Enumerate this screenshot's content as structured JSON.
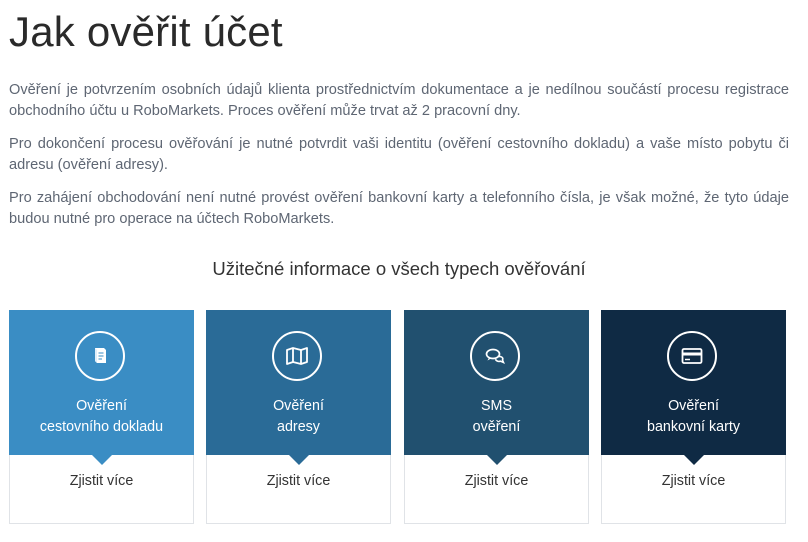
{
  "page": {
    "title": "Jak ověřit účet",
    "paragraphs": [
      "Ověření je potvrzením osobních údajů klienta prostřednictvím dokumentace a je nedílnou součástí procesu registrace obchodního účtu u RoboMarkets. Proces ověření může trvat až 2 pracovní dny.",
      "Pro dokončení procesu ověřování je nutné potvrdit vaši identitu (ověření cestovního dokladu) a vaše místo pobytu či adresu (ověření adresy).",
      "Pro zahájení obchodování není nutné provést ověření bankovní karty a telefonního čísla, je však možné, že tyto údaje budou nutné pro operace na účtech RoboMarkets."
    ],
    "subtitle": "Užitečné informace o všech typech ověřování"
  },
  "cards": [
    {
      "icon": "passport-icon",
      "color": "#3a8dc4",
      "label_line1": "Ověření",
      "label_line2": "cestovního dokladu",
      "link": "Zjistit více"
    },
    {
      "icon": "map-icon",
      "color": "#2a6b97",
      "label_line1": "Ověření",
      "label_line2": "adresy",
      "link": "Zjistit více"
    },
    {
      "icon": "chat-icon",
      "color": "#21506f",
      "label_line1": "SMS",
      "label_line2": "ověření",
      "link": "Zjistit více"
    },
    {
      "icon": "credit-card-icon",
      "color": "#0f2a44",
      "label_line1": "Ověření",
      "label_line2": "bankovní karty",
      "link": "Zjistit více"
    }
  ]
}
